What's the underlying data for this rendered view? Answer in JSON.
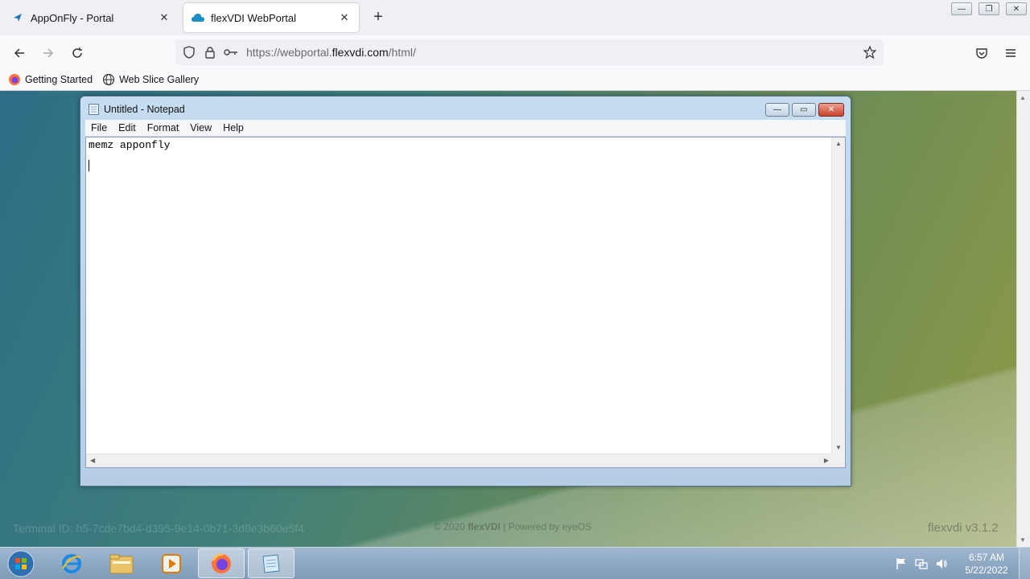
{
  "browser": {
    "tabs": [
      {
        "label": "AppOnFly - Portal",
        "icon": "send-arrow-icon",
        "active": false
      },
      {
        "label": "flexVDI WebPortal",
        "icon": "cloud-icon",
        "active": true
      }
    ],
    "url": {
      "prefix": "https://webportal.",
      "domain": "flexvdi.com",
      "path": "/html/"
    },
    "bookmarks": [
      {
        "label": "Getting Started",
        "icon": "firefox-icon"
      },
      {
        "label": "Web Slice Gallery",
        "icon": "globe-icon"
      }
    ]
  },
  "notepad": {
    "title": "Untitled - Notepad",
    "menu": [
      "File",
      "Edit",
      "Format",
      "View",
      "Help"
    ],
    "content": "memz apponfly"
  },
  "portal_footer": {
    "terminal_id": "Terminal ID: h5-7cde7bd4-d395-9e14-0b71-3d8e3b60e5f4",
    "copyright": "© 2020",
    "brand": "flexVDI",
    "powered": "| Powered by eyeOS",
    "version": "flexvdi v3.1.2"
  },
  "taskbar": {
    "time": "6:57 AM",
    "date": "5/22/2022"
  },
  "colors": {
    "accent": "#0060df",
    "taskbar": "#8ba6c2",
    "notepad_frame": "#bcd3ea"
  }
}
